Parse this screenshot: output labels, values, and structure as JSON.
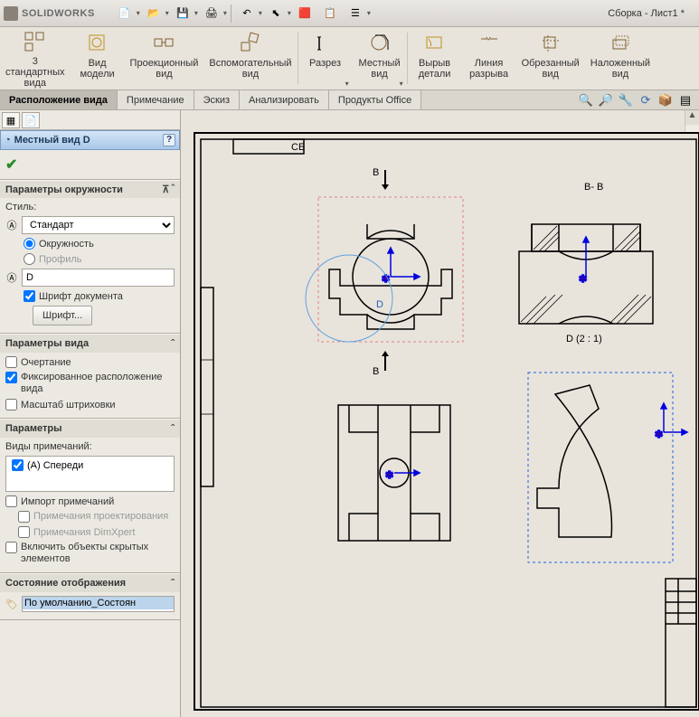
{
  "app_name": "SOLIDWORKS",
  "doc_title": "Сборка - Лист1 *",
  "ribbon": [
    {
      "label": "3\nстандартных\nвида",
      "icon": "views3"
    },
    {
      "label": "Вид\nмодели",
      "icon": "view-model"
    },
    {
      "label": "Проекционный\nвид",
      "icon": "proj-view"
    },
    {
      "label": "Вспомогательный\nвид",
      "icon": "aux-view"
    },
    {
      "label": "Разрез",
      "icon": "section",
      "arrow": true
    },
    {
      "label": "Местный\nвид",
      "icon": "detail-view",
      "arrow": true
    },
    {
      "label": "Вырыв\nдетали",
      "icon": "broken-out"
    },
    {
      "label": "Линия\nразрыва",
      "icon": "break-line"
    },
    {
      "label": "Обрезанный\nвид",
      "icon": "crop-view"
    },
    {
      "label": "Наложенный\nвид",
      "icon": "alt-pos"
    }
  ],
  "tabs": [
    "Расположение вида",
    "Примечание",
    "Эскиз",
    "Анализировать",
    "Продукты Office"
  ],
  "active_tab": 0,
  "panel_title": "Местный вид D",
  "sections": {
    "circle_params": {
      "title": "Параметры окружности",
      "style_label": "Стиль:",
      "style_value": "Стандарт",
      "opt_circle": "Окружность",
      "opt_profile": "Профиль",
      "name_value": "D",
      "doc_font": "Шрифт документа",
      "font_btn": "Шрифт..."
    },
    "view_params": {
      "title": "Параметры вида",
      "outline": "Очертание",
      "fixed": "Фиксированное расположение вида",
      "hatch_scale": "Масштаб штриховки"
    },
    "params": {
      "title": "Параметры",
      "ann_types": "Виды примечаний:",
      "front": "(A) Спереди",
      "import_ann": "Импорт примечаний",
      "proj_ann": "Примечания проектирования",
      "dimxpert": "Примечания DimXpert",
      "hidden": "Включить объекты скрытых элементов"
    },
    "display_state": {
      "title": "Состояние отображения",
      "value": "По умолчанию_Состоян"
    }
  },
  "drawing": {
    "section_mark": "B",
    "section_label": "B- B",
    "detail_label": "D  (2 : 1)",
    "detail_letter": "D"
  }
}
